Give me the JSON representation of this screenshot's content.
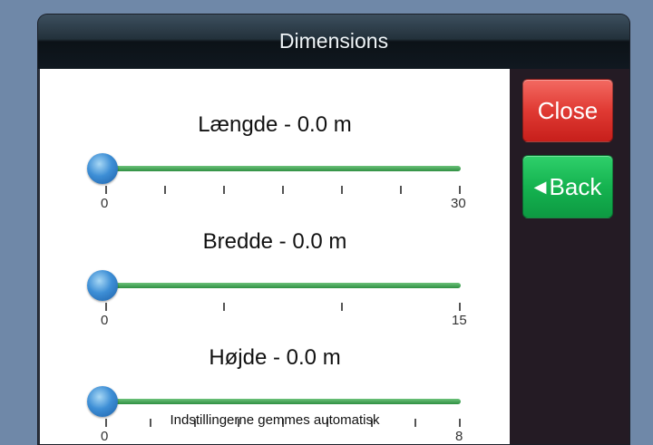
{
  "window": {
    "title": "Dimensions"
  },
  "sidebar": {
    "close_label": "Close",
    "back_label": "Back",
    "back_arrow": "◀"
  },
  "sliders": [
    {
      "title": "Længde - 0.0 m",
      "min": "0",
      "max": "30",
      "value": 0,
      "ticks": 7
    },
    {
      "title": "Bredde - 0.0 m",
      "min": "0",
      "max": "15",
      "value": 0,
      "ticks": 4
    },
    {
      "title": "Højde - 0.0 m",
      "min": "0",
      "max": "8",
      "value": 0,
      "ticks": 9
    }
  ],
  "footer": {
    "text": "Indstillingerne gemmes automatisk"
  },
  "colors": {
    "close": "#e03a33",
    "back": "#15b350",
    "track": "#3fa552",
    "knob": "#3e8fd6"
  }
}
